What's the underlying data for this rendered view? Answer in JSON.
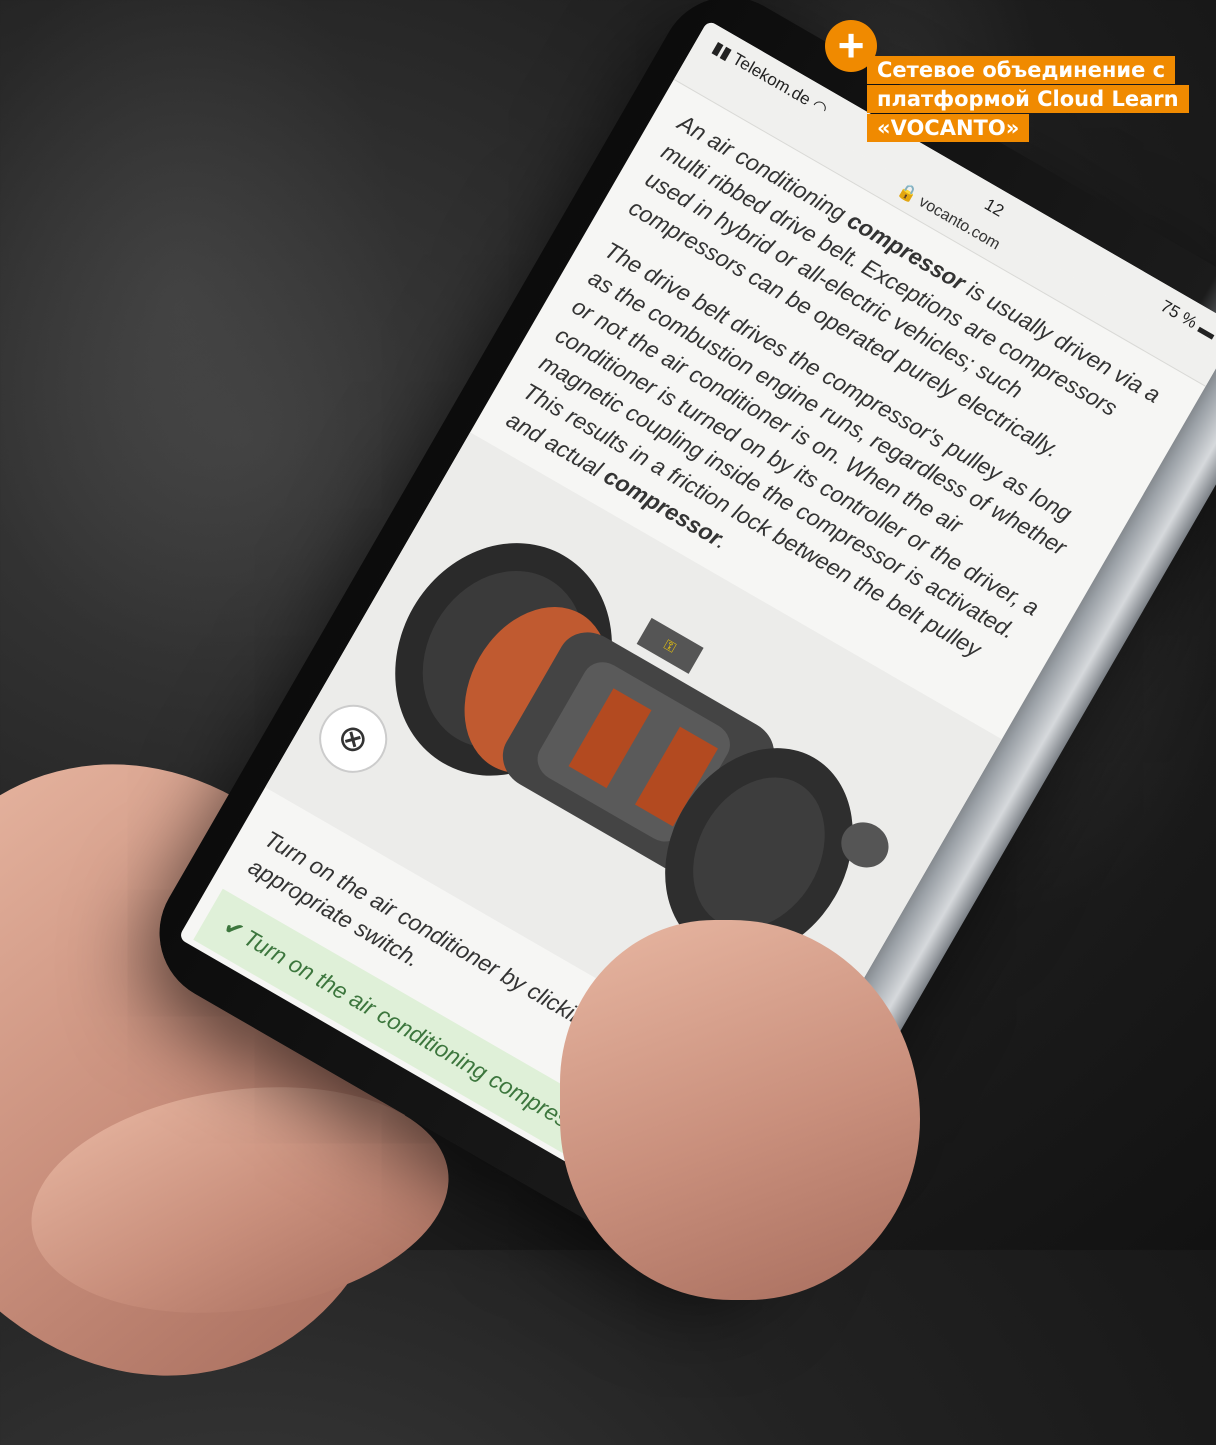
{
  "overlay": {
    "headline_line1": "Сетевое объединение с",
    "headline_line2": "платформой Cloud Learn",
    "headline_line3": "«VOCANTO»",
    "plus_symbol": "+",
    "accent_color": "#f08a00"
  },
  "phone": {
    "status": {
      "carrier": "Telekom.de",
      "signal_icon": "signal-bars-icon",
      "wifi_icon": "wifi-icon",
      "time": "12",
      "battery": "75 %"
    },
    "url": "vocanto.com",
    "article": {
      "p1_before": "An air conditioning ",
      "p1_bold": "compressor",
      "p1_after": " is usually driven via a multi ribbed drive belt. Exceptions are compressors used in hybrid or all-electric vehicles; such compressors can be operated purely electrically.",
      "p2_before": "The drive belt drives the compressor's pulley as long as the combustion engine runs, regardless of whether or not the air conditioner is on. When the air conditioner is turned on by its controller or the driver, a magnetic coupling inside the compressor is activated. This results in a friction lock between the belt pulley and actual ",
      "p2_bold": "compressor",
      "p2_after": "."
    },
    "viewer": {
      "move_icon": "move-arrows-icon",
      "menu_icon": "hamburger-menu-icon",
      "tool_icon": "key-tool-icon"
    },
    "task": "Turn on the air conditioner by clicking on the appropriate switch.",
    "success": "Turn on the air conditioning compressor.",
    "success_icon": "checkmark-icon"
  }
}
